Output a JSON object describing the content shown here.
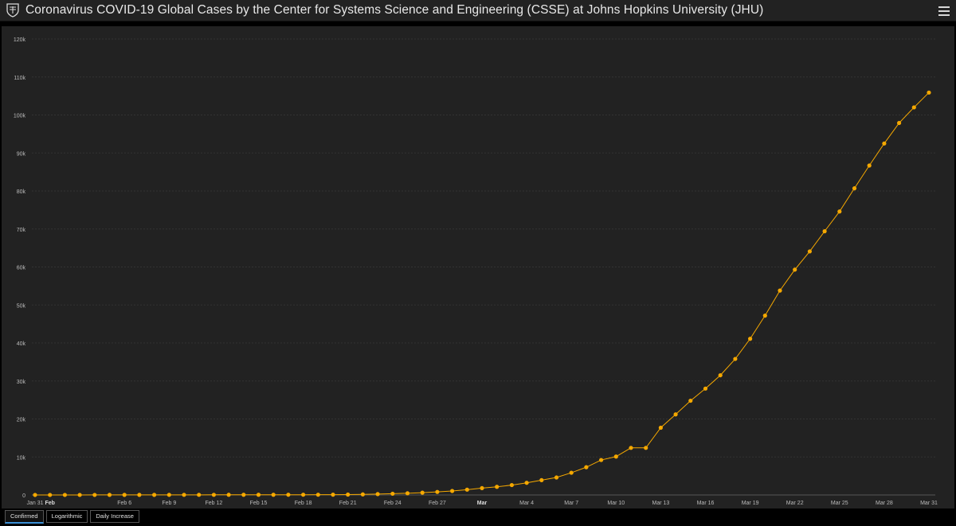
{
  "header": {
    "title": "Coronavirus COVID-19 Global Cases by the Center for Systems Science and Engineering (CSSE) at Johns Hopkins University (JHU)",
    "logo_icon": "jhu-shield-icon",
    "menu_icon": "hamburger-menu-icon"
  },
  "tabs": [
    {
      "label": "Confirmed",
      "active": true
    },
    {
      "label": "Logarithmic",
      "active": false
    },
    {
      "label": "Daily Increase",
      "active": false
    }
  ],
  "colors": {
    "series": "#f5a800",
    "background": "#222222",
    "tab_active": "#3a8fd6"
  },
  "chart_data": {
    "type": "line",
    "grid": true,
    "ylim": [
      0,
      120000
    ],
    "y_ticks": [
      {
        "value": 0,
        "label": "0"
      },
      {
        "value": 10000,
        "label": "10k"
      },
      {
        "value": 20000,
        "label": "20k"
      },
      {
        "value": 30000,
        "label": "30k"
      },
      {
        "value": 40000,
        "label": "40k"
      },
      {
        "value": 50000,
        "label": "50k"
      },
      {
        "value": 60000,
        "label": "60k"
      },
      {
        "value": 70000,
        "label": "70k"
      },
      {
        "value": 80000,
        "label": "80k"
      },
      {
        "value": 90000,
        "label": "90k"
      },
      {
        "value": 100000,
        "label": "100k"
      },
      {
        "value": 110000,
        "label": "110k"
      },
      {
        "value": 120000,
        "label": "120k"
      }
    ],
    "x_ticks": [
      {
        "index": 0,
        "label": "Jan 31",
        "bold": false
      },
      {
        "index": 1,
        "label": "Feb",
        "bold": true
      },
      {
        "index": 6,
        "label": "Feb 6",
        "bold": false
      },
      {
        "index": 9,
        "label": "Feb 9",
        "bold": false
      },
      {
        "index": 12,
        "label": "Feb 12",
        "bold": false
      },
      {
        "index": 15,
        "label": "Feb 15",
        "bold": false
      },
      {
        "index": 18,
        "label": "Feb 18",
        "bold": false
      },
      {
        "index": 21,
        "label": "Feb 21",
        "bold": false
      },
      {
        "index": 24,
        "label": "Feb 24",
        "bold": false
      },
      {
        "index": 27,
        "label": "Feb 27",
        "bold": false
      },
      {
        "index": 30,
        "label": "Mar",
        "bold": true
      },
      {
        "index": 33,
        "label": "Mar 4",
        "bold": false
      },
      {
        "index": 36,
        "label": "Mar 7",
        "bold": false
      },
      {
        "index": 39,
        "label": "Mar 10",
        "bold": false
      },
      {
        "index": 42,
        "label": "Mar 13",
        "bold": false
      },
      {
        "index": 45,
        "label": "Mar 16",
        "bold": false
      },
      {
        "index": 48,
        "label": "Mar 19",
        "bold": false
      },
      {
        "index": 51,
        "label": "Mar 22",
        "bold": false
      },
      {
        "index": 54,
        "label": "Mar 25",
        "bold": false
      },
      {
        "index": 57,
        "label": "Mar 28",
        "bold": false
      },
      {
        "index": 60,
        "label": "Mar 31",
        "bold": false
      }
    ],
    "series": [
      {
        "values": [
          6,
          8,
          11,
          13,
          16,
          19,
          21,
          25,
          29,
          32,
          35,
          38,
          42,
          45,
          48,
          52,
          56,
          60,
          64,
          70,
          80,
          100,
          150,
          230,
          330,
          450,
          600,
          800,
          1050,
          1400,
          1800,
          2150,
          2600,
          3200,
          3900,
          4600,
          5850,
          7300,
          9200,
          10100,
          12400,
          12400,
          17700,
          21200,
          24800,
          28000,
          31500,
          35800,
          41100,
          47200,
          53800,
          59300,
          64100,
          69400,
          74600,
          80700,
          86700,
          92500,
          97900,
          102000,
          105900
        ]
      }
    ]
  }
}
